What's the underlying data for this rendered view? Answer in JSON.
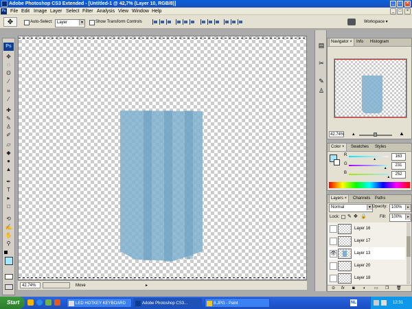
{
  "window": {
    "title": "Adobe Photoshop CS3 Extended - [Untitled-1 @ 42,7% (Layer 10, RGB/8)]",
    "controls": [
      "_",
      "□",
      "×"
    ]
  },
  "menu": [
    "File",
    "Edit",
    "Image",
    "Layer",
    "Select",
    "Filter",
    "Analysis",
    "View",
    "Window",
    "Help"
  ],
  "options": {
    "auto_select_label": "Auto-Select:",
    "auto_select_value": "Layer",
    "show_transform_label": "Show Transform Controls",
    "workspace_label": "Workspace ▾"
  },
  "document": {
    "shape_color": "#7fb0cf",
    "stripe_color": "#6a9dbf"
  },
  "status": {
    "zoom": "42.74%",
    "tool": "Move"
  },
  "navigator": {
    "tabs": [
      "Navigator ×",
      "Info",
      "Histogram"
    ],
    "zoom": "42.74%"
  },
  "color_panel": {
    "tabs": [
      "Color ×",
      "Swatches",
      "Styles"
    ],
    "channels": [
      {
        "label": "R",
        "value": "163",
        "level": 0.64
      },
      {
        "label": "G",
        "value": "231",
        "level": 0.91
      },
      {
        "label": "B",
        "value": "252",
        "level": 0.99
      }
    ],
    "foreground": "#a3e7fc"
  },
  "layers_panel": {
    "tabs": [
      "Layers ×",
      "Channels",
      "Paths"
    ],
    "blend_mode": "Normal",
    "opacity_label": "Opacity:",
    "opacity_value": "100%",
    "lock_label": "Lock:",
    "fill_label": "Fill:",
    "fill_value": "100%",
    "layers": [
      {
        "name": "Layer 16",
        "visible": false,
        "selected": false
      },
      {
        "name": "Layer 17",
        "visible": false,
        "selected": false
      },
      {
        "name": "Layer 13",
        "visible": true,
        "selected": true
      },
      {
        "name": "Layer 20",
        "visible": false,
        "selected": false
      },
      {
        "name": "Layer 18",
        "visible": false,
        "selected": false
      }
    ]
  },
  "taskbar": {
    "start": "Start",
    "tasks": [
      "LED HOTKEY KEYBOARD",
      "Adobe Photoshop CS3...",
      "8.JPG - Paint"
    ],
    "clock": "12:31"
  }
}
